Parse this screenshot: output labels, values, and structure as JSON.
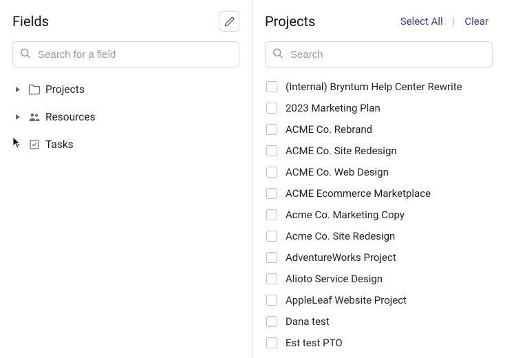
{
  "fields_panel": {
    "title": "Fields",
    "search_placeholder": "Search for a field",
    "tree": [
      {
        "label": "Projects",
        "icon": "folder"
      },
      {
        "label": "Resources",
        "icon": "people"
      },
      {
        "label": "Tasks",
        "icon": "check-square"
      }
    ]
  },
  "projects_panel": {
    "title": "Projects",
    "select_all_label": "Select All",
    "clear_label": "Clear",
    "search_placeholder": "Search",
    "items": [
      "(Internal) Bryntum Help Center Rewrite",
      "2023 Marketing Plan",
      "ACME Co. Rebrand",
      "ACME Co. Site Redesign",
      "ACME Co. Web Design",
      "ACME Ecommerce Marketplace",
      "Acme Co. Marketing Copy",
      "Acme Co. Site Redesign",
      "AdventureWorks Project",
      "Alioto Service Design",
      "AppleLeaf Website Project",
      "Dana test",
      "Est test PTO"
    ]
  }
}
